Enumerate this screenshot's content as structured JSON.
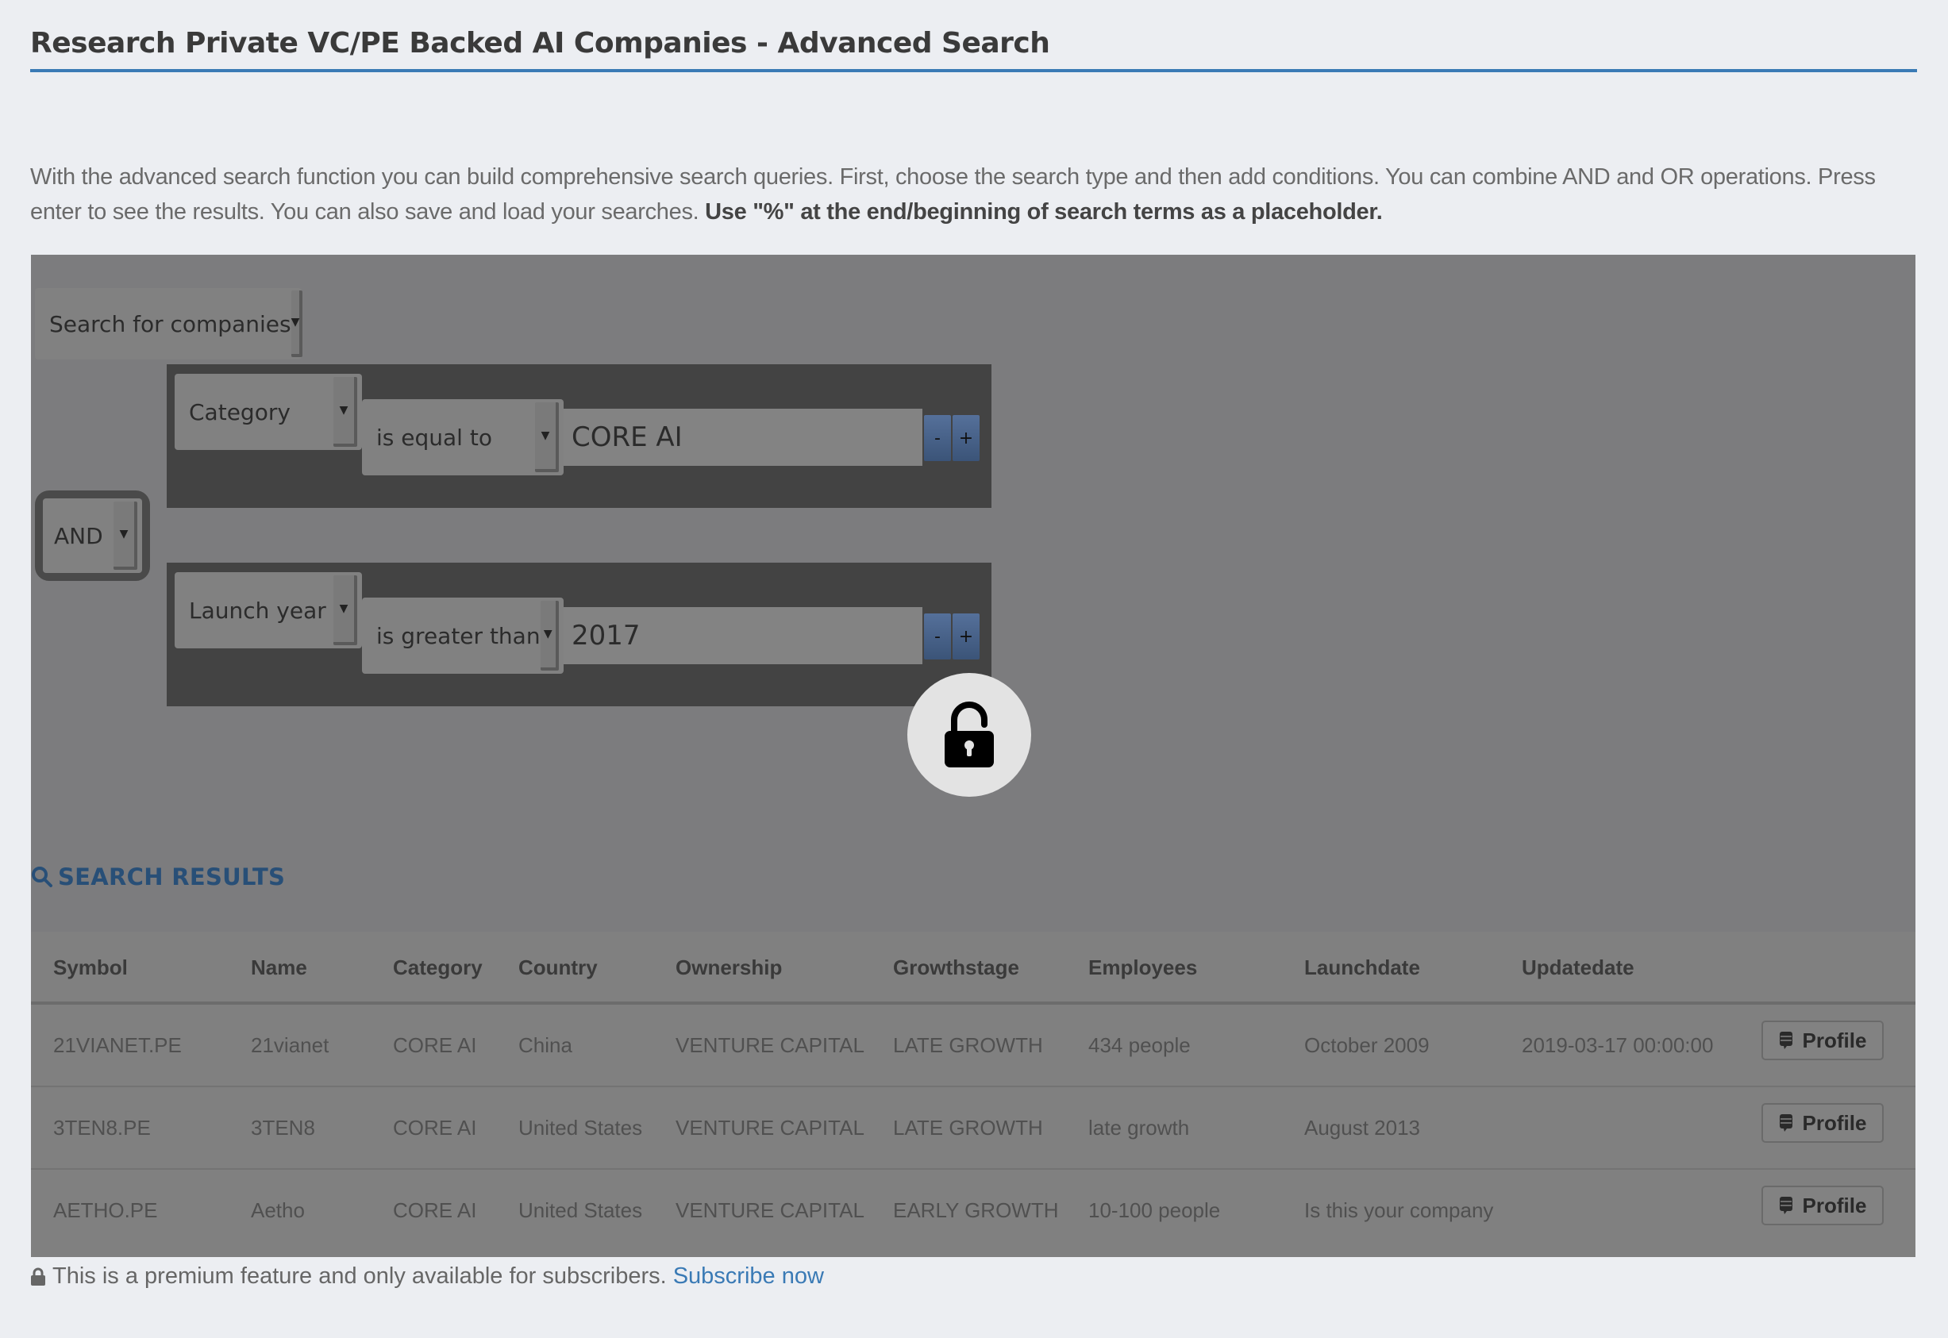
{
  "page": {
    "title": "Research Private VC/PE Backed AI Companies - Advanced Search",
    "intro_text": "With the advanced search function you can build comprehensive search queries. First, choose the search type and then add conditions. You can combine AND and OR operations. Press enter to see the results. You can also save and load your searches. ",
    "intro_bold": "Use \"%\" at the end/beginning of search terms as a placeholder.",
    "accent_color": "#3a7ab5"
  },
  "search_builder": {
    "search_type": "Search for companies",
    "logic_operator": "AND",
    "conditions": [
      {
        "field": "Category",
        "operator": "is equal to",
        "value": "CORE AI",
        "minus_label": "-",
        "plus_label": "+"
      },
      {
        "field": "Launch year",
        "operator": "is greater than",
        "value": "2017",
        "minus_label": "-",
        "plus_label": "+"
      }
    ],
    "lock_icon": "unlock-icon"
  },
  "results": {
    "heading": "SEARCH RESULTS",
    "heading_icon": "search-icon",
    "columns": [
      "Symbol",
      "Name",
      "Category",
      "Country",
      "Ownership",
      "Growthstage",
      "Employees",
      "Launchdate",
      "Updatedate"
    ],
    "rows": [
      [
        "21VIANET.PE",
        "21vianet",
        "CORE AI",
        "China",
        "VENTURE CAPITAL",
        "LATE GROWTH",
        "434 people",
        "October 2009",
        "2019-03-17 00:00:00"
      ],
      [
        "3TEN8.PE",
        "3TEN8",
        "CORE AI",
        "United States",
        "VENTURE CAPITAL",
        "LATE GROWTH",
        "late growth",
        "August 2013",
        ""
      ],
      [
        "AETHO.PE",
        "Aetho",
        "CORE AI",
        "United States",
        "VENTURE CAPITAL",
        "EARLY GROWTH",
        "10-100 people",
        "Is this your company",
        ""
      ]
    ],
    "profile_label": "Profile",
    "profile_icon": "comment-icon"
  },
  "footer": {
    "lock_icon": "lock-icon",
    "note": "This is a premium feature and only available for subscribers.",
    "subscribe_link": "Subscribe now"
  }
}
